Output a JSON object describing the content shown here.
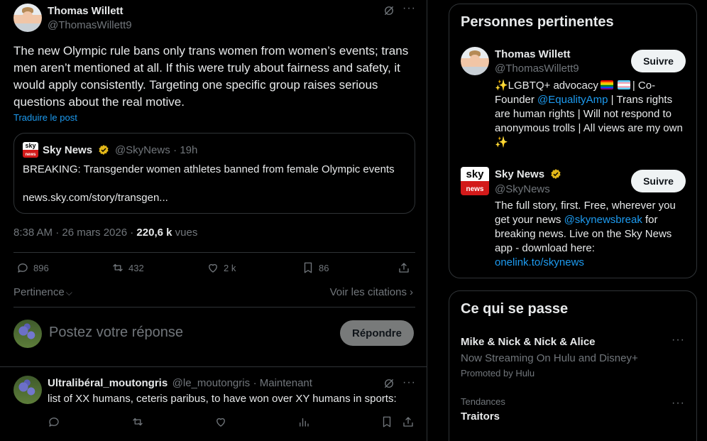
{
  "post": {
    "author_name": "Thomas Willett",
    "author_handle": "@ThomasWillett9",
    "text": "The new Olympic rule bans only trans women from women’s events; trans men aren’t mentioned at all. If this were truly about fairness and safety, it would apply consistently. Targeting one specific group raises serious questions about the real motive.",
    "translate_label": "Traduire le post",
    "quote": {
      "logo_top": "sky",
      "logo_bottom": "news",
      "author_name": "Sky News",
      "author_handle": "@SkyNews",
      "time": "· 19h",
      "text": "BREAKING: Transgender women athletes banned from female Olympic events",
      "link": "news.sky.com/story/transgen..."
    },
    "timestamp": "8:38 AM · 26 mars 2026 · ",
    "views_count": "220,6 k",
    "views_label": " vues",
    "stats": {
      "replies": "896",
      "reposts": "432",
      "likes": "2 k",
      "bookmarks": "86"
    },
    "sort_label": "Pertinence",
    "quotes_label": "Voir les citations"
  },
  "reply_box": {
    "placeholder": "Postez votre réponse",
    "button_label": "Répondre"
  },
  "reply": {
    "author_name": "Ultralibéral_moutongris",
    "author_handle": "@le_moutongris",
    "time": "· Maintenant",
    "text": "list of XX humans, ceteris paribus, to have won over XY humans in sports:"
  },
  "sidebar": {
    "relevant": {
      "title": "Personnes pertinentes",
      "follow_label": "Suivre",
      "people": [
        {
          "name": "Thomas Willett",
          "handle": "@ThomasWillett9",
          "bio_1": "✨LGBTQ+ advocacy",
          "bio_2": "| Co-Founder ",
          "bio_link": "@EqualityAmp",
          "bio_3": " | Trans rights are human rights | Will not respond to anonymous trolls | All views are my own ✨"
        },
        {
          "name": "Sky News",
          "handle": "@SkyNews",
          "logo_top": "sky",
          "logo_bottom": "news",
          "bio_1": "The full story, first. Free, wherever you get your news ",
          "bio_link": "@skynewsbreak",
          "bio_2": " for breaking news. Live on the Sky News app - download here: ",
          "bio_link_2": "onelink.to/skynews"
        }
      ]
    },
    "happening": {
      "title": "Ce qui se passe",
      "items": [
        {
          "title": "Mike & Nick & Nick & Alice",
          "subtitle": "Now Streaming On Hulu and Disney+",
          "meta": "Promoted by Hulu"
        },
        {
          "category": "Tendances",
          "title": "Traitors"
        }
      ]
    }
  },
  "colors": {
    "accent": "#1d9bf0",
    "background": "#000000",
    "border": "#2f3336",
    "muted": "#71767b",
    "verified": "#e2b719"
  }
}
